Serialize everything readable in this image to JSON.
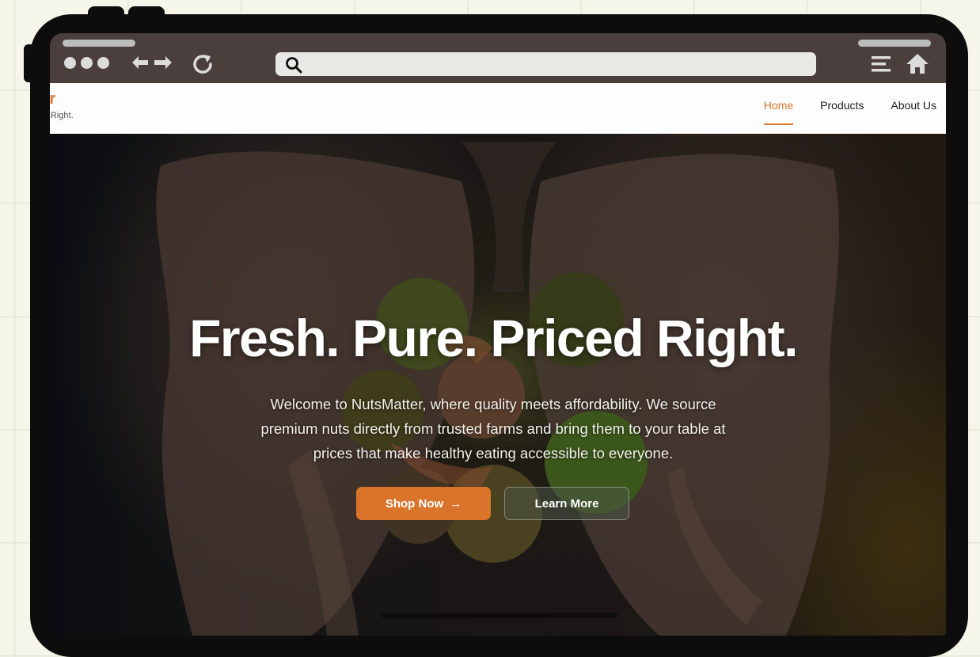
{
  "browser": {
    "icons": [
      "window-dots-icon",
      "back-forward-arrows-icon",
      "reload-icon",
      "search-icon",
      "menu-icon",
      "home-icon"
    ],
    "address_value": ""
  },
  "site": {
    "brand": {
      "name": "tter",
      "tagline": "riced Right."
    },
    "nav": {
      "links": [
        {
          "label": "Home",
          "active": true
        },
        {
          "label": "Products",
          "active": false
        },
        {
          "label": "About Us",
          "active": false
        }
      ]
    },
    "hero": {
      "headline": "Fresh. Pure. Priced Right.",
      "lines": [
        "Welcome to NutsMatter, where quality meets affordability. We source",
        "premium nuts directly from trusted farms and bring them to your table at",
        "prices that make healthy eating accessible to everyone."
      ],
      "shop_label": "Shop Now",
      "shop_arrow": "→",
      "learn_label": "Learn More"
    }
  },
  "colors": {
    "accent": "#d9782d",
    "frame": "#0d0d0d",
    "toolbar": "#4b3f3e",
    "background": "#f5f5e9"
  }
}
